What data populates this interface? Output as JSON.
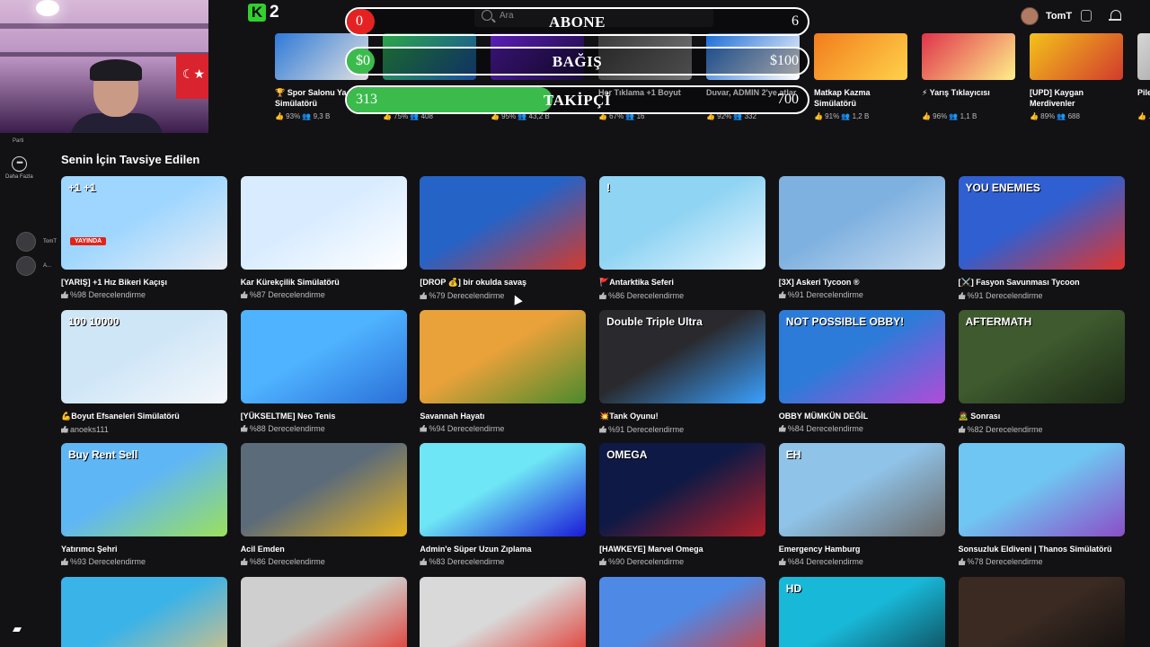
{
  "topbar": {
    "logo": "K",
    "logo_num": "2",
    "search_placeholder": "Ara",
    "username": "TomT"
  },
  "overlay": [
    {
      "left": "0",
      "title": "ABONE",
      "right": "6",
      "fill_color": "#e52222",
      "fill_fraction": 0.05
    },
    {
      "left": "$0",
      "title": "BAĞIŞ",
      "right": "$100",
      "fill_color": "#3bbb4c",
      "fill_fraction": 0.05
    },
    {
      "left": "313",
      "title": "TAKİPÇİ",
      "right": "700",
      "fill_color": "#3bbb4c",
      "fill_fraction": 0.447
    }
  ],
  "rail": {
    "party_label": "Parti",
    "more_label": "Daha Fazla",
    "friends": [
      "TomT",
      "A..."
    ]
  },
  "carousel": [
    {
      "name": "🏆 Spor Salonu Ya... Simülatörü",
      "stats": "👍 93%  👥 9,3 B",
      "color1": "#2f7ad8",
      "color2": "#e0e0e0"
    },
    {
      "name": "",
      "stats": "👍 75%  👥 408",
      "color1": "#2aa845",
      "color2": "#1a4d9e"
    },
    {
      "name": "...ma",
      "stats": "👍 95%  👥 43,2 B",
      "color1": "#5b1fb8",
      "color2": "#1a0b3d"
    },
    {
      "name": "Her Tıklama +1 Boyut",
      "stats": "👍 67%  👥 16",
      "color1": "#3a3a3a",
      "color2": "#777"
    },
    {
      "name": "Duvar, ADMIN 2'ye atlar",
      "stats": "👍 92%  👥 332",
      "color1": "#1b6bd6",
      "color2": "#fff"
    },
    {
      "name": "Matkap Kazma Simülatörü",
      "stats": "👍 91%  👥 1,2 B",
      "color1": "#f27c1d",
      "color2": "#ffd24a"
    },
    {
      "name": "⚡ Yarış Tıklayıcısı",
      "stats": "👍 96%  👥 1,1 B",
      "color1": "#e0334b",
      "color2": "#ffef8a"
    },
    {
      "name": "[UPD] Kaygan Merdivenler",
      "stats": "👍 89%  👥 688",
      "color1": "#f4c21a",
      "color2": "#d13b2c"
    },
    {
      "name": "Pile...",
      "stats": "👍 ...",
      "color1": "#d7d7d7",
      "color2": "#888"
    }
  ],
  "section": {
    "title": "Senin İçin Tavsiye Edilen"
  },
  "cards": [
    {
      "title": "[YARIŞ] +1 Hız Bikeri Kaçışı",
      "stat": "%98 Derecelendirme",
      "c1": "#9ed6ff",
      "c2": "#e9eef5",
      "text": "+1  +1",
      "live": "YAYINDA"
    },
    {
      "title": "Kar Kürekçilik Simülatörü",
      "stat": "%87 Derecelendirme",
      "c1": "#d9ecff",
      "c2": "#ffffff",
      "text": "",
      "live": ""
    },
    {
      "title": "[DROP 💰] bir okulda savaş",
      "stat": "%79 Derecelendirme",
      "c1": "#2563c7",
      "c2": "#d33a2c",
      "text": "",
      "live": ""
    },
    {
      "title": "🚩Antarktika Seferi",
      "stat": "%86 Derecelendirme",
      "c1": "#8fd4f3",
      "c2": "#e8f6ff",
      "text": "!",
      "live": ""
    },
    {
      "title": "[3X] Askeri Tycoon ®",
      "stat": "%91 Derecelendirme",
      "c1": "#7fb1e0",
      "c2": "#c7dcf0",
      "text": "",
      "live": ""
    },
    {
      "title": "[⚔️] Fasyon Savunması Tycoon",
      "stat": "%91 Derecelendirme",
      "c1": "#2f5fd1",
      "c2": "#e2342c",
      "text": "YOU  ENEMIES",
      "live": ""
    },
    {
      "title": "💪Boyut Efsaneleri Simülatörü",
      "stat": "anoeks111",
      "c1": "#cfe6f7",
      "c2": "#f3f7fb",
      "text": "100  10000",
      "live": ""
    },
    {
      "title": "[YÜKSELTME] Neo Tenis",
      "stat": "%88 Derecelendirme",
      "c1": "#4fb3ff",
      "c2": "#2a6fd8",
      "text": "",
      "live": ""
    },
    {
      "title": "Savannah Hayatı",
      "stat": "%94 Derecelendirme",
      "c1": "#e9a13a",
      "c2": "#4b8a2d",
      "text": "",
      "live": ""
    },
    {
      "title": "💥Tank Oyunu!",
      "stat": "%91 Derecelendirme",
      "c1": "#2a2a2e",
      "c2": "#3aa0ff",
      "text": "Double  Triple  Ultra",
      "live": ""
    },
    {
      "title": "OBBY MÜMKÜN DEĞİL",
      "stat": "%84 Derecelendirme",
      "c1": "#2d7bd8",
      "c2": "#b04cd8",
      "text": "NOT POSSIBLE OBBY!",
      "live": ""
    },
    {
      "title": "🧟 Sonrası",
      "stat": "%82 Derecelendirme",
      "c1": "#3e5a2e",
      "c2": "#1c2a16",
      "text": "AFTERMATH",
      "live": ""
    },
    {
      "title": "Yatırımcı Şehri",
      "stat": "%93 Derecelendirme",
      "c1": "#5fb6f5",
      "c2": "#9be05c",
      "text": "Buy Rent Sell",
      "live": ""
    },
    {
      "title": "Acil Emden",
      "stat": "%86 Derecelendirme",
      "c1": "#5b6b7a",
      "c2": "#e6b21e",
      "text": "",
      "live": ""
    },
    {
      "title": "Admin'e Süper Uzun Zıplama",
      "stat": "%83 Derecelendirme",
      "c1": "#6ee6f5",
      "c2": "#1a1ad8",
      "text": "",
      "live": ""
    },
    {
      "title": "[HAWKEYE] Marvel Omega",
      "stat": "%90 Derecelendirme",
      "c1": "#0e1a45",
      "c2": "#b0202a",
      "text": "OMEGA",
      "live": ""
    },
    {
      "title": "Emergency Hamburg",
      "stat": "%84 Derecelendirme",
      "c1": "#8fc3e8",
      "c2": "#6b6b6b",
      "text": "EH",
      "live": ""
    },
    {
      "title": "Sonsuzluk Eldiveni | Thanos Simülatörü",
      "stat": "%78 Derecelendirme",
      "c1": "#6fc6f2",
      "c2": "#8a4ec7",
      "text": "",
      "live": ""
    },
    {
      "title": "",
      "stat": "",
      "c1": "#3ab3e8",
      "c2": "#e8c27a",
      "text": "",
      "live": ""
    },
    {
      "title": "",
      "stat": "",
      "c1": "#cfcfcf",
      "c2": "#e2231a",
      "text": "",
      "live": ""
    },
    {
      "title": "",
      "stat": "",
      "c1": "#d9d9d9",
      "c2": "#e2231a",
      "text": "",
      "live": ""
    },
    {
      "title": "",
      "stat": "",
      "c1": "#4e89e6",
      "c2": "#e23a2a",
      "text": "",
      "live": ""
    },
    {
      "title": "",
      "stat": "",
      "c1": "#18b8d8",
      "c2": "#0d3d4a",
      "text": "HD",
      "live": ""
    },
    {
      "title": "",
      "stat": "",
      "c1": "#3a2a22",
      "c2": "#0c0c0c",
      "text": "",
      "live": ""
    }
  ]
}
